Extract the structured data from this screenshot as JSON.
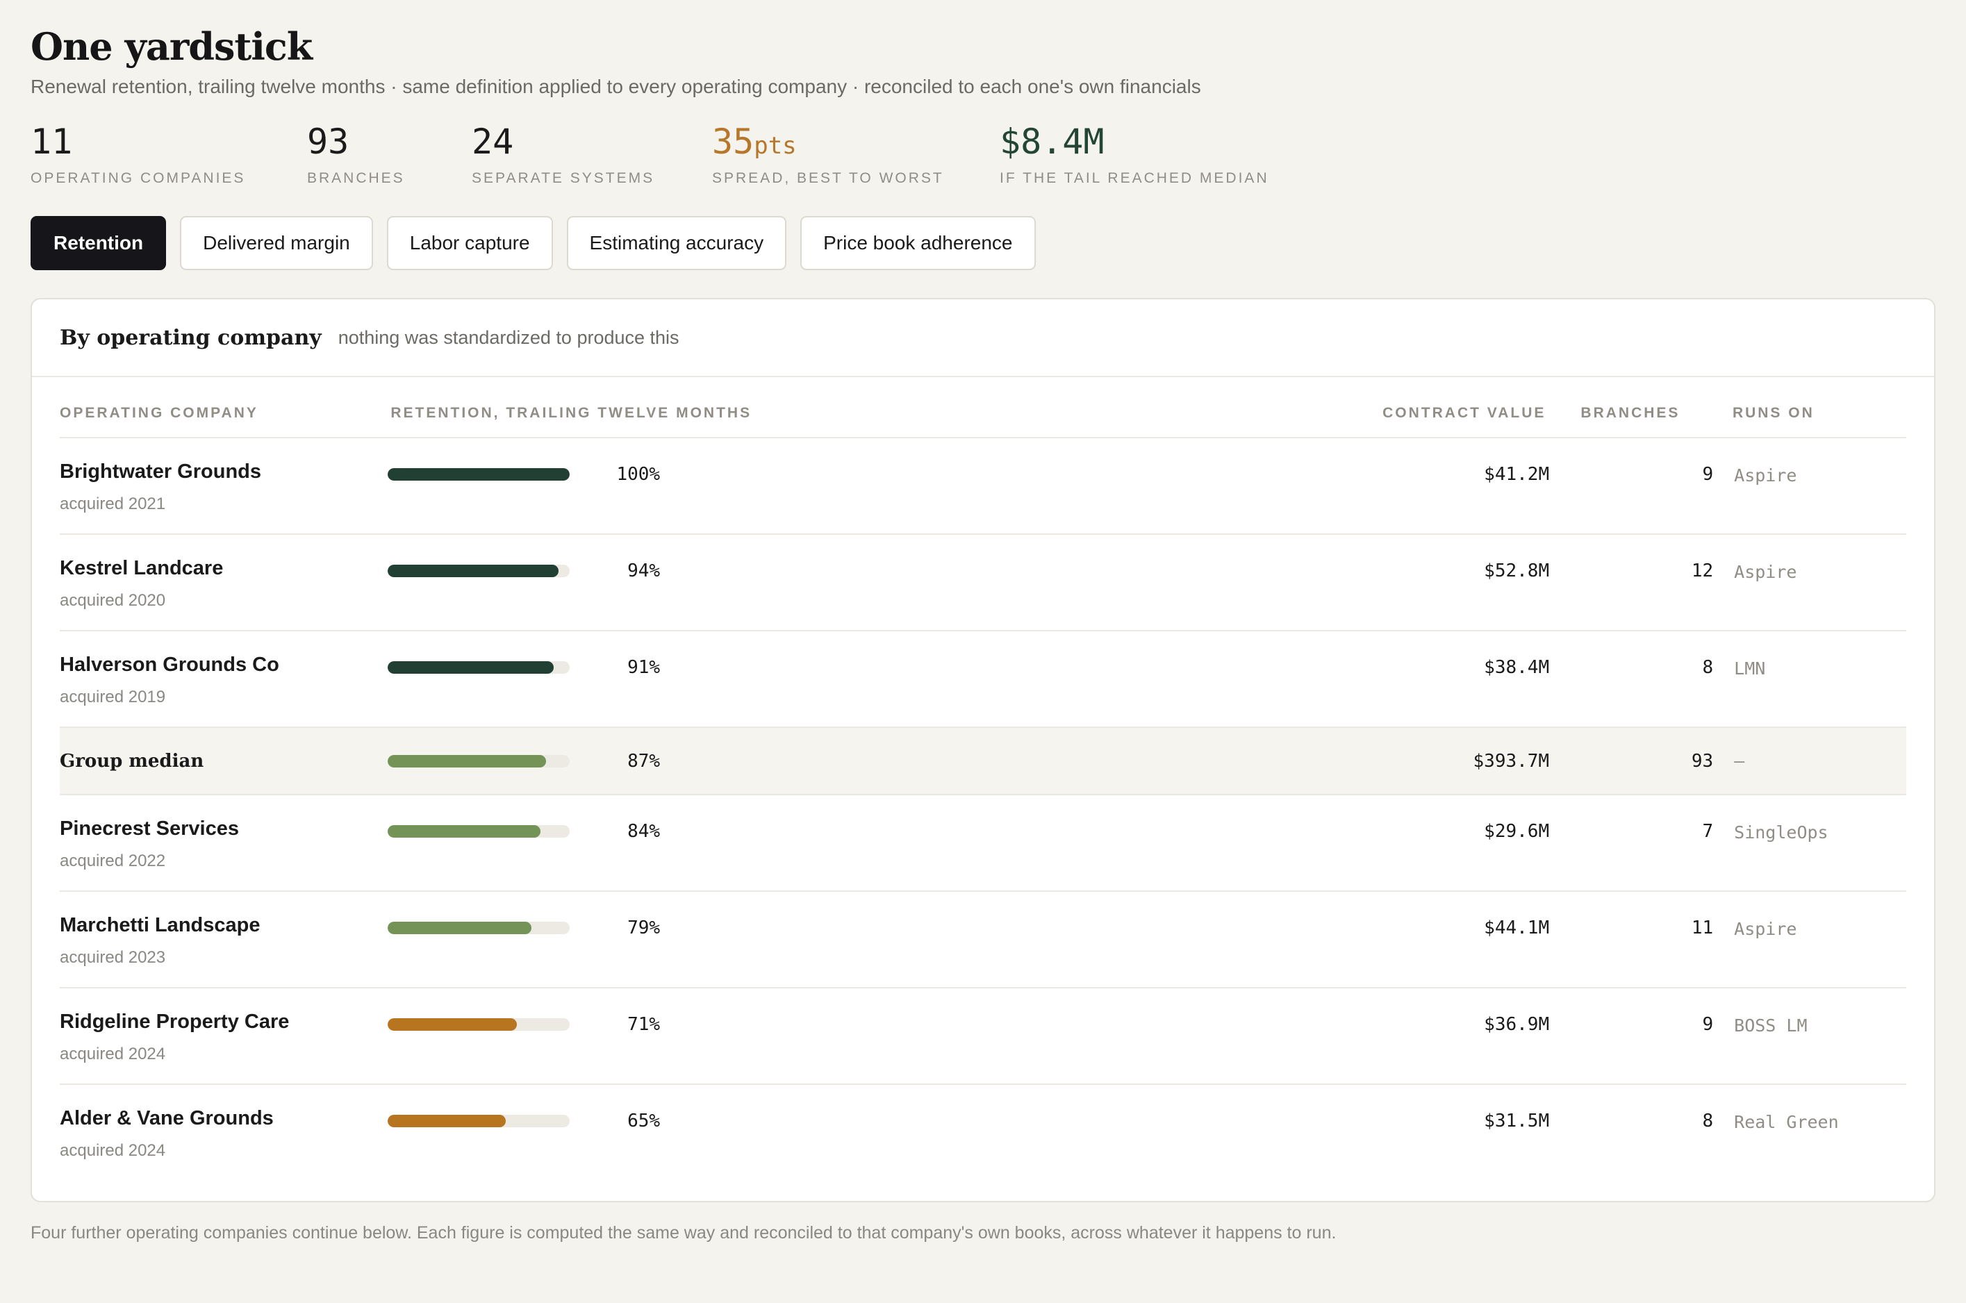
{
  "header": {
    "title": "One yardstick",
    "subtitle": "Renewal retention, trailing twelve months · same definition applied to every operating company · reconciled to each one's own financials"
  },
  "stats": [
    {
      "value": "11",
      "unit": "",
      "label": "Operating companies"
    },
    {
      "value": "93",
      "unit": "",
      "label": "Branches"
    },
    {
      "value": "24",
      "unit": "",
      "label": "Separate systems"
    },
    {
      "value": "35",
      "unit": "pts",
      "label": "Spread, best to worst"
    },
    {
      "value": "$8.4M",
      "unit": "",
      "label": "If the tail reached median"
    }
  ],
  "tabs": [
    {
      "label": "Retention",
      "active": true
    },
    {
      "label": "Delivered margin",
      "active": false
    },
    {
      "label": "Labor capture",
      "active": false
    },
    {
      "label": "Estimating accuracy",
      "active": false
    },
    {
      "label": "Price book adherence",
      "active": false
    }
  ],
  "card": {
    "title": "By operating company",
    "note": "nothing was standardized to produce this"
  },
  "table": {
    "columns": {
      "company": "Operating company",
      "retention": "Retention, trailing twelve months",
      "contract_value": "Contract value",
      "branches": "Branches",
      "runs_on": "Runs on"
    },
    "colors": {
      "high": "#223f33",
      "mid": "#739357",
      "low": "#b8751f"
    },
    "rows": [
      {
        "name": "Brightwater Grounds",
        "acquired": "acquired 2021",
        "retention": 100,
        "retention_label": "100%",
        "tier": "high",
        "contract_value": "$41.2M",
        "branches": "9",
        "runs_on": "Aspire"
      },
      {
        "name": "Kestrel Landcare",
        "acquired": "acquired 2020",
        "retention": 94,
        "retention_label": "94%",
        "tier": "high",
        "contract_value": "$52.8M",
        "branches": "12",
        "runs_on": "Aspire"
      },
      {
        "name": "Halverson Grounds Co",
        "acquired": "acquired 2019",
        "retention": 91,
        "retention_label": "91%",
        "tier": "high",
        "contract_value": "$38.4M",
        "branches": "8",
        "runs_on": "LMN"
      },
      {
        "name": "Group median",
        "acquired": "",
        "retention": 87,
        "retention_label": "87%",
        "tier": "mid",
        "median": true,
        "contract_value": "$393.7M",
        "branches": "93",
        "runs_on": "—"
      },
      {
        "name": "Pinecrest Services",
        "acquired": "acquired 2022",
        "retention": 84,
        "retention_label": "84%",
        "tier": "mid",
        "contract_value": "$29.6M",
        "branches": "7",
        "runs_on": "SingleOps"
      },
      {
        "name": "Marchetti Landscape",
        "acquired": "acquired 2023",
        "retention": 79,
        "retention_label": "79%",
        "tier": "mid",
        "contract_value": "$44.1M",
        "branches": "11",
        "runs_on": "Aspire"
      },
      {
        "name": "Ridgeline Property Care",
        "acquired": "acquired 2024",
        "retention": 71,
        "retention_label": "71%",
        "tier": "low",
        "contract_value": "$36.9M",
        "branches": "9",
        "runs_on": "BOSS LM"
      },
      {
        "name": "Alder & Vane Grounds",
        "acquired": "acquired 2024",
        "retention": 65,
        "retention_label": "65%",
        "tier": "low",
        "contract_value": "$31.5M",
        "branches": "8",
        "runs_on": "Real Green"
      }
    ]
  },
  "footer": {
    "text": "Four further operating companies continue below. Each figure is computed the same way and reconciled to that company's own books, across whatever it happens to run."
  }
}
